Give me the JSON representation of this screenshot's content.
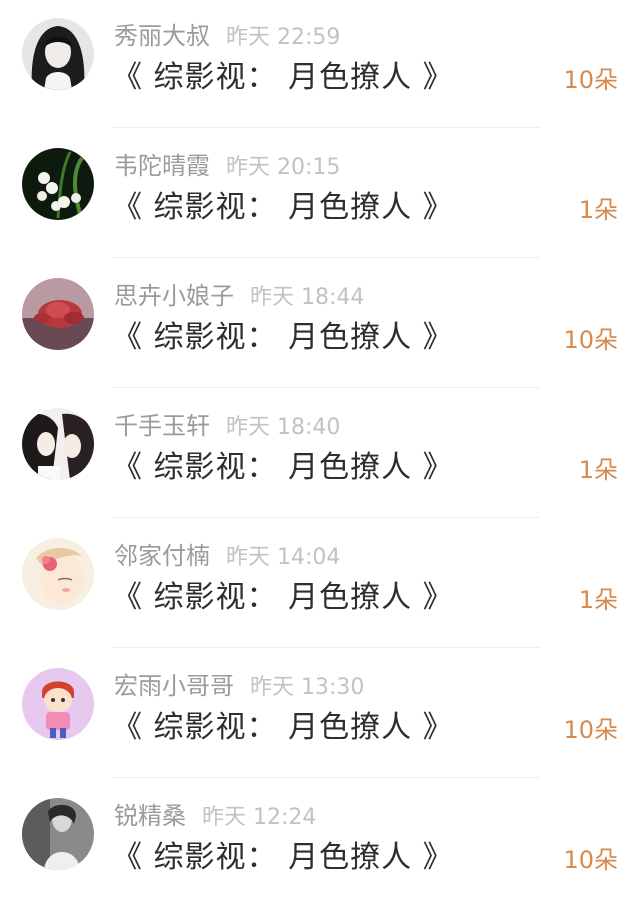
{
  "colors": {
    "accent": "#d9894a",
    "name_text": "#9b9b9b",
    "time_text": "#c2c2c2",
    "title_text": "#2e2e2e"
  },
  "items": [
    {
      "name": "秀丽大叔",
      "time": "昨天 22:59",
      "title": "《 综影视： 月色撩人 》",
      "amount": "10朵",
      "avatar": "girl-portrait-avatar"
    },
    {
      "name": "韦陀晴霞",
      "time": "昨天 20:15",
      "title": "《 综影视： 月色撩人 》",
      "amount": "1朵",
      "avatar": "lily-of-valley-avatar"
    },
    {
      "name": "思卉小娘子",
      "time": "昨天 18:44",
      "title": "《 综影视： 月色撩人 》",
      "amount": "10朵",
      "avatar": "red-rose-avatar"
    },
    {
      "name": "千手玉轩",
      "time": "昨天 18:40",
      "title": "《 综影视： 月色撩人 》",
      "amount": "1朵",
      "avatar": "anime-couple-avatar"
    },
    {
      "name": "邻家付楠",
      "time": "昨天 14:04",
      "title": "《 综影视： 月色撩人 》",
      "amount": "1朵",
      "avatar": "illustrated-girl-avatar"
    },
    {
      "name": "宏雨小哥哥",
      "time": "昨天 13:30",
      "title": "《 综影视： 月色撩人 》",
      "amount": "10朵",
      "avatar": "cartoon-boy-avatar"
    },
    {
      "name": "锐精桑",
      "time": "昨天 12:24",
      "title": "《 综影视： 月色撩人 》",
      "amount": "10朵",
      "avatar": "gray-photo-avatar"
    }
  ]
}
